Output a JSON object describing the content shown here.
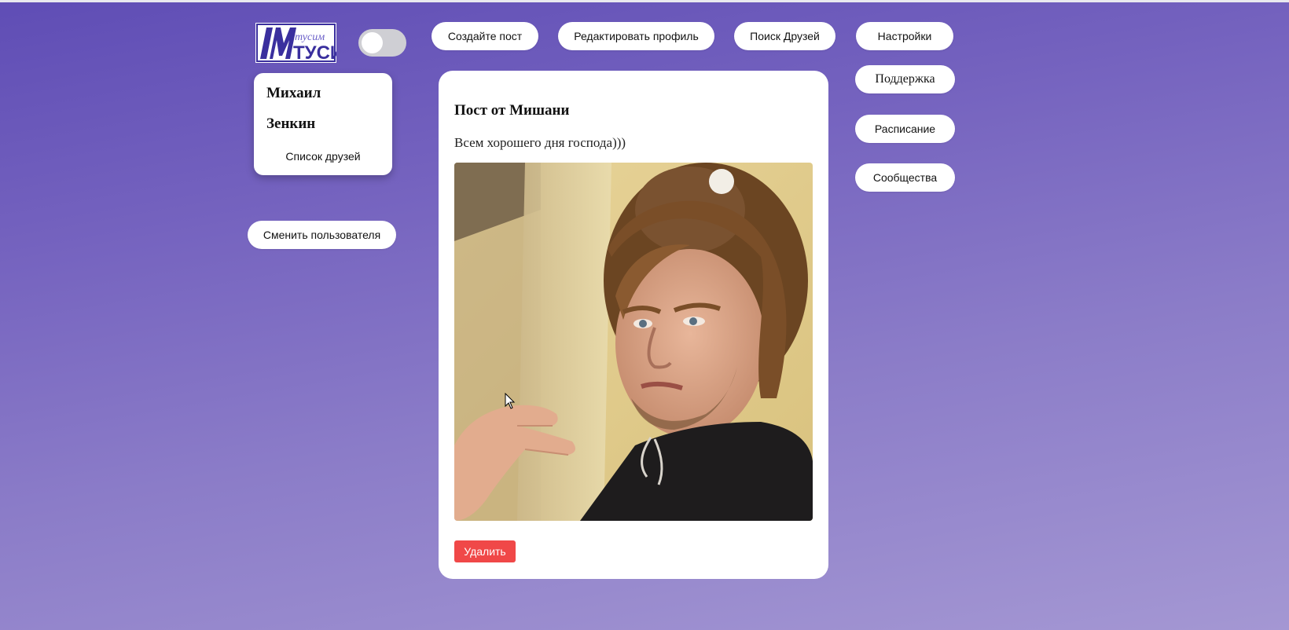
{
  "logo": {
    "text_top": "тусим",
    "text_bottom": "ТУСИ",
    "monogram": "ИМ"
  },
  "theme_toggle": {
    "state": "off"
  },
  "header": {
    "create_post": "Создайте пост",
    "edit_profile": "Редактировать профиль",
    "find_friends": "Поиск Друзей",
    "settings": "Настройки"
  },
  "right_nav": {
    "support": "Поддержка",
    "schedule": "Расписание",
    "communities": "Сообщества"
  },
  "profile": {
    "first_name": "Михаил",
    "last_name": "Зенкин",
    "friends_link": "Список друзей"
  },
  "switch_user": "Сменить пользователя",
  "post": {
    "title": "Пост от Мишани",
    "text": "Всем хорошего дня господа)))",
    "delete_label": "Удалить"
  },
  "colors": {
    "accent_delete": "#f04848",
    "logo_blue": "#3a2f9e",
    "bg_top": "#5f4db5",
    "bg_bottom": "#a497d3"
  }
}
